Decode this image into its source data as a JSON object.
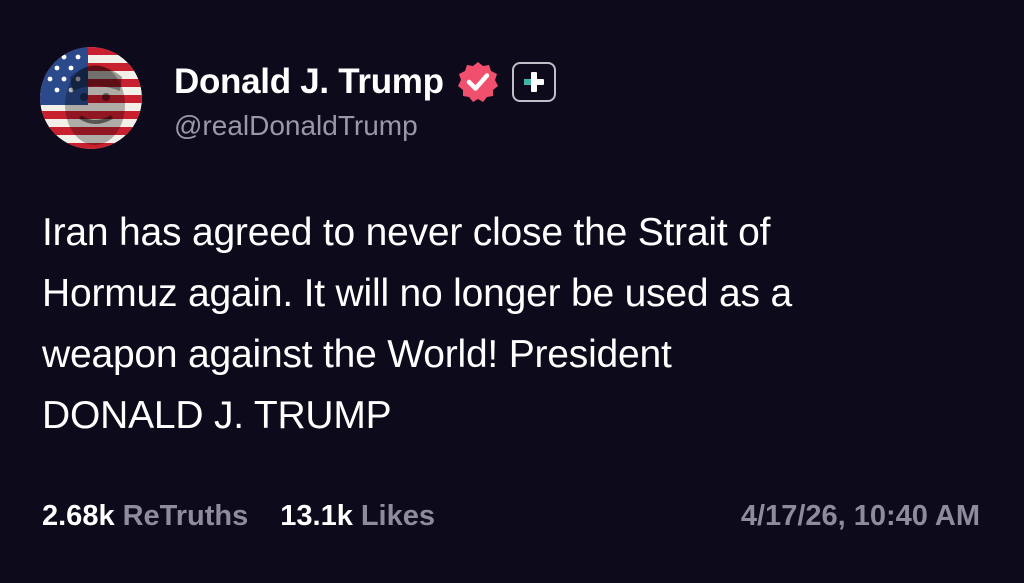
{
  "post": {
    "author": {
      "display_name": "Donald J. Trump",
      "handle": "@realDonaldTrump",
      "avatar_icon": "flag-portrait-avatar",
      "verified_icon": "verified-badge-icon",
      "follow_icon": "plus-icon",
      "verified_color": "#f0506e"
    },
    "body_lines": [
      "Iran has agreed to never close the Strait of",
      "Hormuz again. It will no longer be used as a",
      "weapon against the World! President",
      "DONALD J. TRUMP"
    ],
    "stats": {
      "retruths_count": "2.68k",
      "retruths_label": "ReTruths",
      "likes_count": "13.1k",
      "likes_label": "Likes"
    },
    "timestamp": "4/17/26, 10:40 AM"
  },
  "colors": {
    "background": "#0d0a1c",
    "text_primary": "#ffffff",
    "text_secondary": "#8e8c9a",
    "badge": "#f0506e"
  }
}
